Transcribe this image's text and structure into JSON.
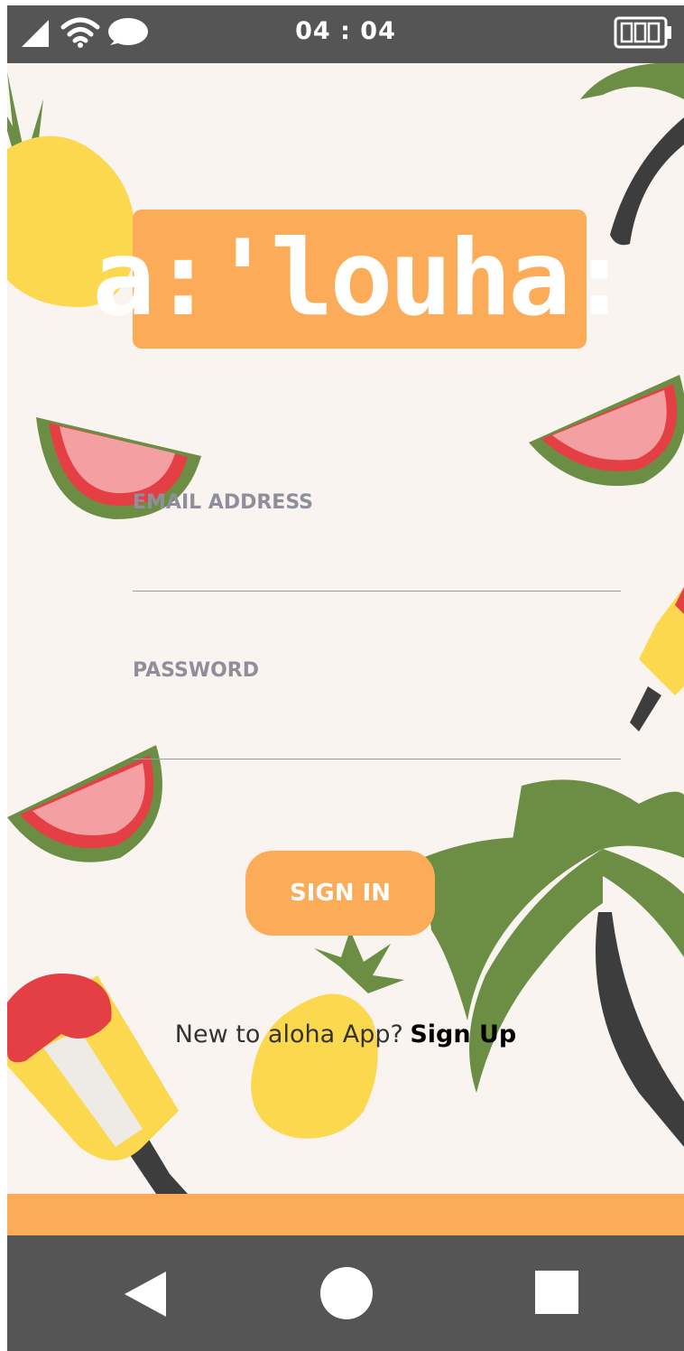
{
  "status_bar": {
    "time": "04 : 04",
    "icons": [
      "cellular-signal-icon",
      "wifi-icon",
      "chat-bubble-icon",
      "battery-icon"
    ]
  },
  "logo": {
    "text": "a:'louha:"
  },
  "form": {
    "email": {
      "label": "EMAIL ADDRESS",
      "value": "",
      "placeholder": ""
    },
    "password": {
      "label": "PASSWORD",
      "value": "",
      "placeholder": ""
    },
    "sign_in_label": "SIGN IN"
  },
  "signup": {
    "prompt": "New to aloha App?",
    "link": "Sign Up"
  },
  "nav_bar": {
    "buttons": [
      "back-icon",
      "home-icon",
      "recents-icon"
    ]
  },
  "colors": {
    "accent": "#fcac58",
    "background": "#f9f4f0",
    "system_bar": "#555555",
    "label": "#8f8f9c",
    "palm": "#6b8e44",
    "watermelon_rind": "#6b8e44",
    "watermelon_flesh": "#f49fa2",
    "watermelon_red": "#e53f46",
    "pineapple": "#fbd84d"
  }
}
